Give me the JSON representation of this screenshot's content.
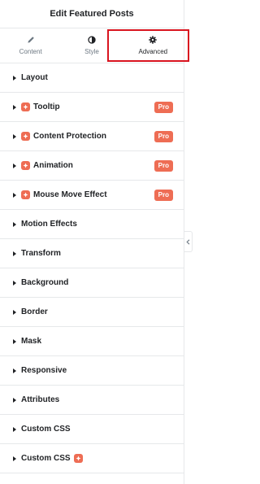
{
  "header": {
    "title": "Edit Featured Posts"
  },
  "tabs": [
    {
      "label": "Content",
      "icon": "pencil-icon",
      "active": false
    },
    {
      "label": "Style",
      "icon": "half-circle-icon",
      "active": false
    },
    {
      "label": "Advanced",
      "icon": "gear-icon",
      "active": true
    }
  ],
  "sections": [
    {
      "label": "Layout"
    },
    {
      "label": "Tooltip",
      "badge": "Pro"
    },
    {
      "label": "Content Protection",
      "badge": "Pro"
    },
    {
      "label": "Animation",
      "badge": "Pro"
    },
    {
      "label": "Mouse Move Effect",
      "badge": "Pro"
    },
    {
      "label": "Motion Effects"
    },
    {
      "label": "Transform"
    },
    {
      "label": "Background"
    },
    {
      "label": "Border"
    },
    {
      "label": "Mask"
    },
    {
      "label": "Responsive"
    },
    {
      "label": "Attributes"
    },
    {
      "label": "Custom CSS"
    },
    {
      "label": "Custom CSS"
    }
  ],
  "colors": {
    "accent": "#ee6d54",
    "highlight": "#d9141f",
    "border": "#e6e8ea"
  }
}
